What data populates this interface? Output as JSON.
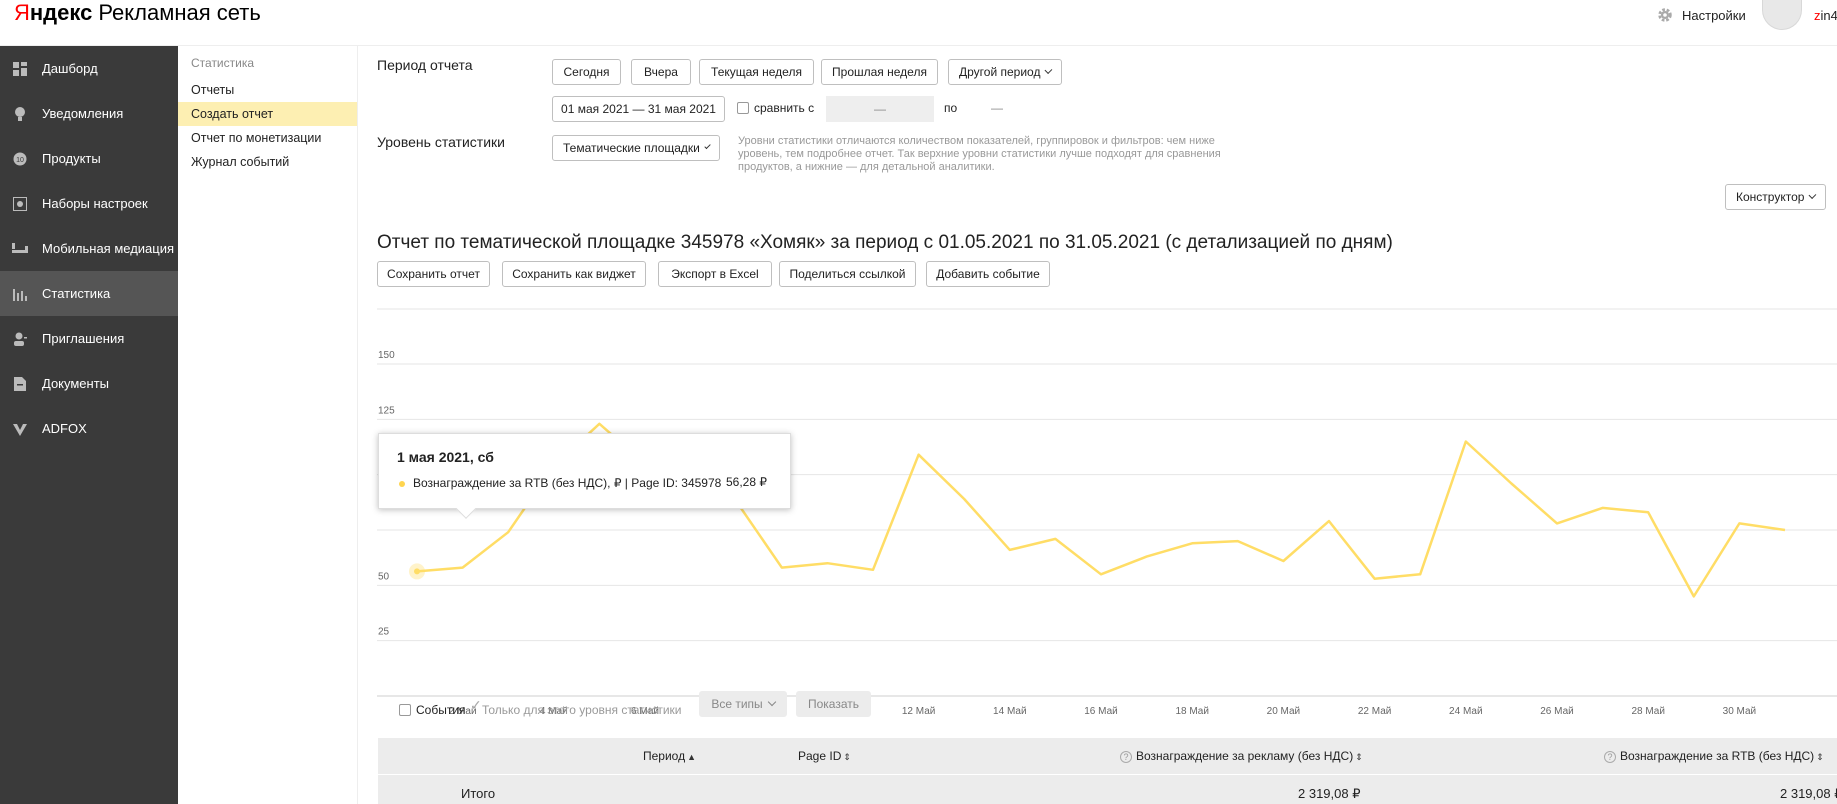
{
  "header": {
    "logo_letter": "Я",
    "logo_bold": "ндекс",
    "logo_rest": "Рекламная сеть",
    "settings_label": "Настройки",
    "username_first": "z",
    "username_rest": "in4"
  },
  "sidebar": {
    "items": [
      {
        "label": "Дашборд",
        "icon": "dashboard-icon"
      },
      {
        "label": "Уведомления",
        "icon": "bulb-icon"
      },
      {
        "label": "Продукты",
        "icon": "products-icon"
      },
      {
        "label": "Наборы настроек",
        "icon": "settings-set-icon"
      },
      {
        "label": "Мобильная медиация",
        "icon": "mediation-icon"
      },
      {
        "label": "Статистика",
        "icon": "statistics-icon"
      },
      {
        "label": "Приглашения",
        "icon": "invite-icon"
      },
      {
        "label": "Документы",
        "icon": "document-icon"
      },
      {
        "label": "ADFOX",
        "icon": "adfox-icon"
      }
    ]
  },
  "submenu": {
    "title": "Статистика",
    "items": [
      "Отчеты",
      "Создать отчет",
      "Отчет по монетизации",
      "Журнал событий"
    ]
  },
  "period": {
    "label": "Период отчета",
    "buttons": [
      "Сегодня",
      "Вчера",
      "Текущая неделя",
      "Прошлая неделя"
    ],
    "other_period": "Другой период",
    "date_range": "01 мая 2021 — 31 мая 2021",
    "compare_label": "сравнить с",
    "compare_from": "—",
    "to_label": "по",
    "compare_to": "—"
  },
  "level": {
    "label": "Уровень статистики",
    "select": "Тематические площадки",
    "hint_lines": [
      "Уровни статистики отличаются количеством показателей, группировок и фильтров: чем ниже",
      "уровень, тем подробнее отчет. Так верхние уровни статистики лучше подходят для сравнения",
      "продуктов, а нижние — для детальной аналитики."
    ]
  },
  "constructor_label": "Конструктор",
  "report": {
    "title": "Отчет по тематической площадке 345978 «Хомяк» за период с 01.05.2021 по 31.05.2021 (с детализацией по дням)",
    "actions": [
      "Сохранить отчет",
      "Сохранить как виджет",
      "Экспорт в Excel",
      "Поделиться ссылкой",
      "Добавить событие"
    ]
  },
  "chart_data": {
    "type": "line",
    "x": [
      "1 май",
      "2 май",
      "3 май",
      "4 май",
      "5 май",
      "6 май",
      "7 май",
      "8 май",
      "9 май",
      "10 май",
      "11 май",
      "12 май",
      "13 май",
      "14 май",
      "15 май",
      "16 май",
      "17 май",
      "18 май",
      "19 май",
      "20 май",
      "21 май",
      "22 май",
      "23 май",
      "24 май",
      "25 май",
      "26 май",
      "27 май",
      "28 май",
      "29 май",
      "30 май",
      "31 май"
    ],
    "x_tick_labels": [
      "2 Май",
      "4 Май",
      "6 Май",
      "8 Май",
      "10 Май",
      "12 Май",
      "14 Май",
      "16 Май",
      "18 Май",
      "20 Май",
      "22 Май",
      "24 Май",
      "26 Май",
      "28 Май",
      "30 Май"
    ],
    "y_ticks": [
      25,
      50,
      75,
      100,
      125,
      150
    ],
    "y_tick_labels": [
      "25",
      "50",
      "",
      "100",
      "125",
      "150"
    ],
    "ylim": [
      0,
      150
    ],
    "series": [
      {
        "name": "Вознаграждение за RTB (без НДС), ₽ | Page ID: 345978",
        "color": "#ffdd66",
        "values": [
          56.28,
          58,
          74,
          104,
          123,
          105,
          92,
          88,
          58,
          60,
          57,
          109,
          89,
          66,
          71,
          55,
          63,
          69,
          70,
          61,
          79,
          53,
          55,
          115,
          96,
          78,
          85,
          83,
          45,
          78,
          75
        ]
      }
    ],
    "grid": true
  },
  "tooltip": {
    "date": "1 мая 2021, сб",
    "series": "Вознаграждение за RTB (без НДС), ₽ | Page ID: 345978",
    "value": "56,28 ₽"
  },
  "events": {
    "events_label": "События",
    "only_level_label": "Только для этого уровня статистики",
    "all_types": "Все типы",
    "show": "Показать"
  },
  "table": {
    "headers": [
      "Период",
      "Page ID",
      "Вознаграждение за рекламу (без НДС)",
      "Вознаграждение за RTB (без НДС)"
    ],
    "total_label": "Итого",
    "total_ad": "2 319,08 ₽",
    "total_rtb": "2 319,08 ₽"
  }
}
